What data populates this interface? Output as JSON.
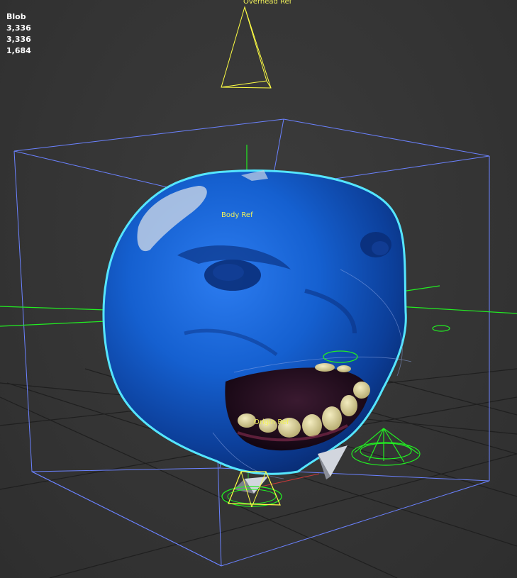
{
  "viewport": {
    "stats": {
      "object_name": "Blob",
      "polys": "3,336",
      "tris": "3,336",
      "verts": "1,684"
    },
    "labels": {
      "overhead_ref": "Overhead Ref",
      "body_ref": "Body Ref",
      "origin_ref": "Origin Ref"
    },
    "colors": {
      "background": "#363636",
      "grid": "#1e1e1e",
      "bounding_box": "#6b82ff",
      "selection_outline": "#55e6ff",
      "mesh": "#1c5fd0",
      "helpers": "#22ee22",
      "camera": "#ffff44",
      "label": "#f2f25a"
    }
  }
}
